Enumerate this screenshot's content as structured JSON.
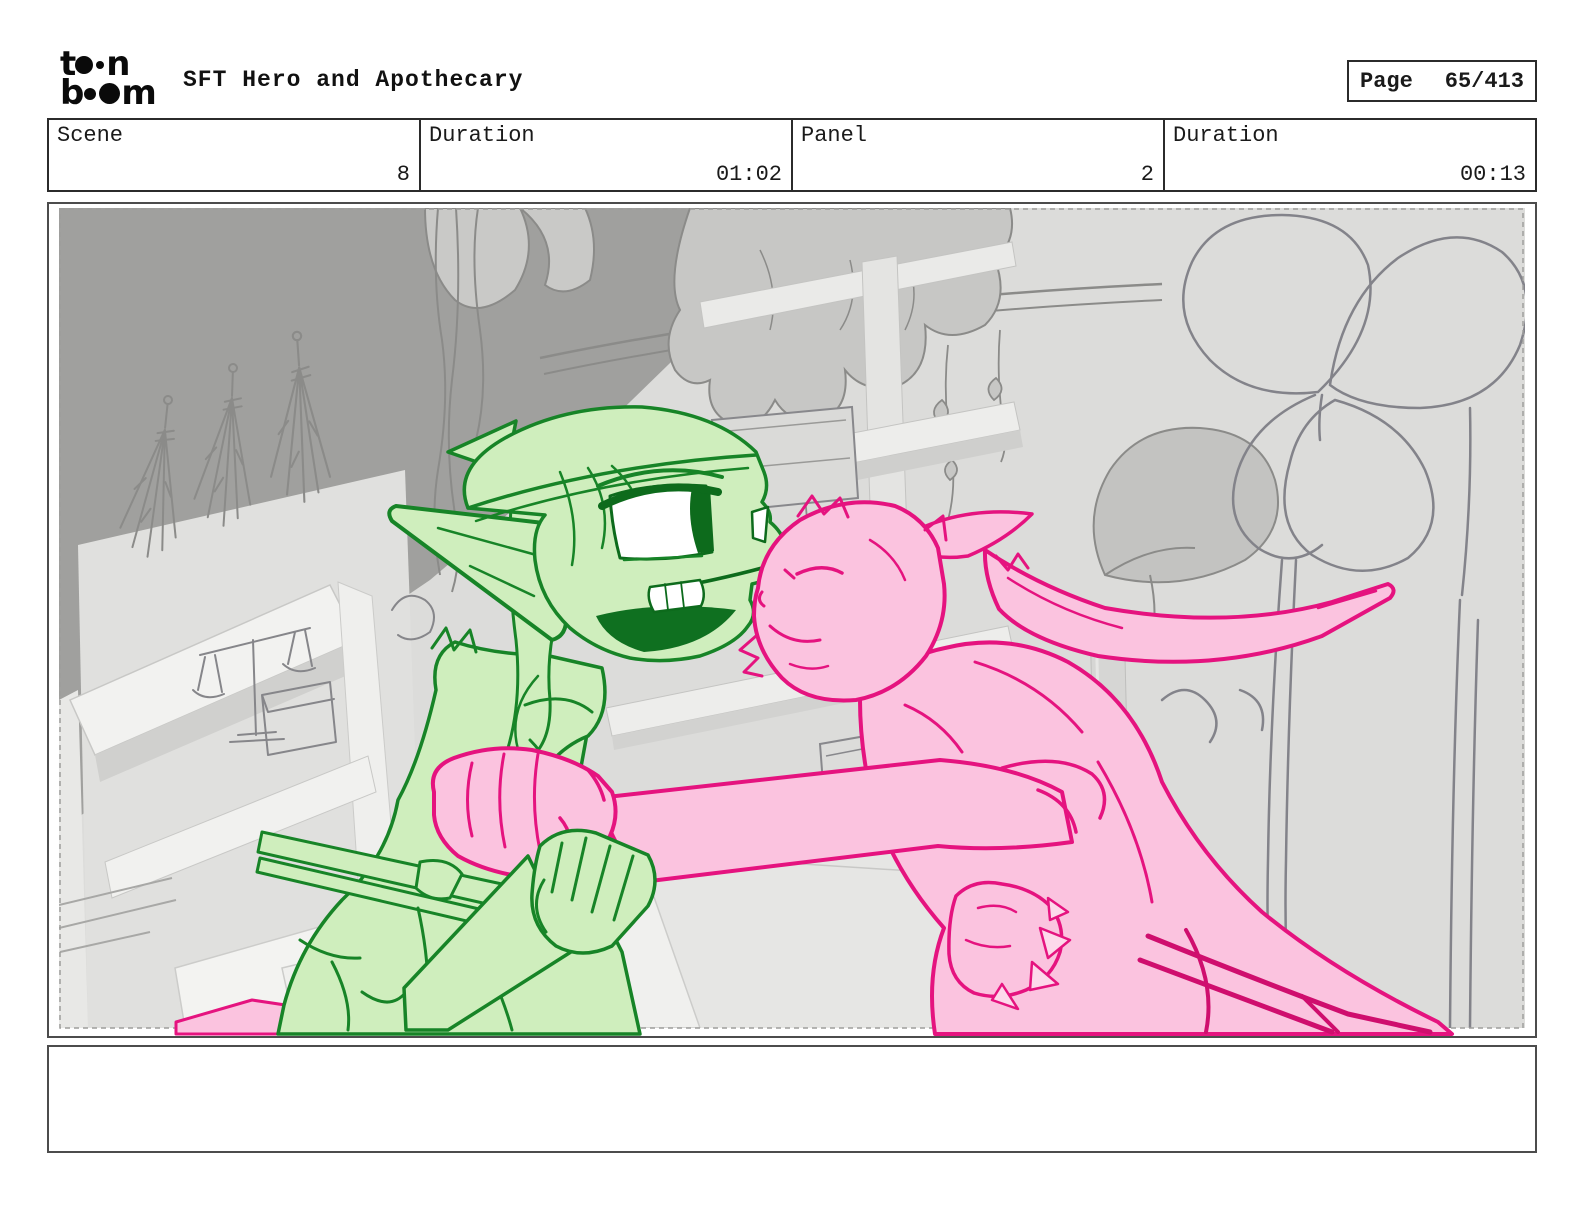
{
  "logo": {
    "line1_start": "t",
    "line1_end": "n",
    "line2_start": "b",
    "line2_end": "m"
  },
  "header": {
    "title": "SFT Hero and Apothecary",
    "page_label": "Page",
    "page_value": "65/413"
  },
  "info_row": {
    "cells": [
      {
        "label": "Scene",
        "value": "8"
      },
      {
        "label": "Duration",
        "value": "01:02"
      },
      {
        "label": "Panel",
        "value": "2"
      },
      {
        "label": "Duration",
        "value": "00:13"
      }
    ]
  },
  "caption": {
    "text": ""
  },
  "colors": {
    "green_character_fill": "#cfeebd",
    "green_character_line": "#178427",
    "green_character_dark": "#0d6b1c",
    "pink_character_fill": "#fbc3df",
    "pink_character_line": "#e5137f",
    "pink_character_dark": "#cf0e6e",
    "wall_dark_gray": "#a0a09e",
    "background_gray": "#dcdcda",
    "sketch_line_gray": "#8b8b89",
    "frame_border": "#4c4c4c",
    "table_border": "#2b2b2b"
  }
}
